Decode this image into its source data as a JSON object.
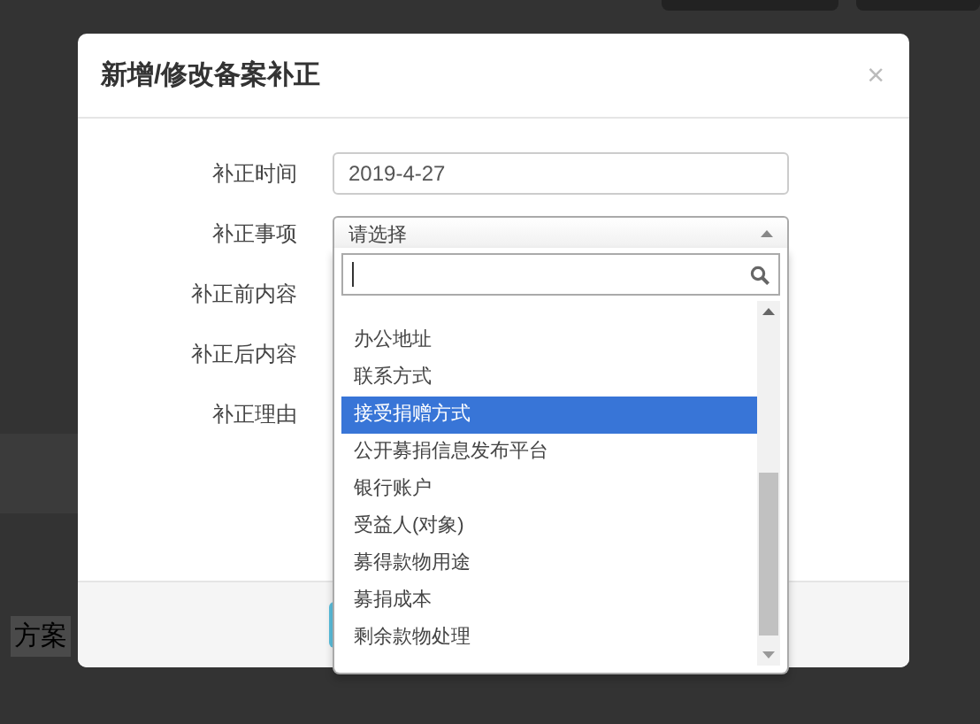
{
  "background_text": "方案",
  "dialog": {
    "title": "新增/修改备案补正",
    "close": "×",
    "fields": [
      {
        "label": "补正时间",
        "kind": "input",
        "value": "2019-4-27"
      },
      {
        "label": "补正事项",
        "kind": "select",
        "value": "请选择",
        "expanded": true
      },
      {
        "label": "补正前内容",
        "kind": "text"
      },
      {
        "label": "补正后内容",
        "kind": "text"
      },
      {
        "label": "补正理由",
        "kind": "text"
      }
    ],
    "dropdown": {
      "items": [
        {
          "label": "办公地址",
          "selected": false
        },
        {
          "label": "联系方式",
          "selected": false
        },
        {
          "label": "接受捐赠方式",
          "selected": true
        },
        {
          "label": "公开募捐信息发布平台",
          "selected": false
        },
        {
          "label": "银行账户",
          "selected": false
        },
        {
          "label": "受益人(对象)",
          "selected": false
        },
        {
          "label": "募得款物用途",
          "selected": false
        },
        {
          "label": "募捐成本",
          "selected": false
        },
        {
          "label": "剩余款物处理",
          "selected": false
        }
      ]
    }
  }
}
